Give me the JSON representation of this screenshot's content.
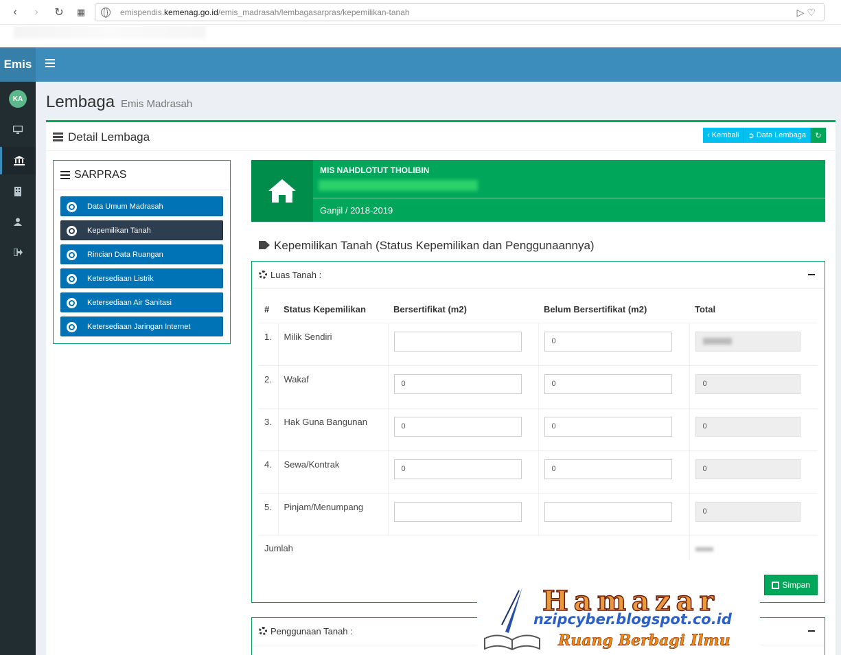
{
  "browser": {
    "url_prefix": "emispendis.",
    "url_domain": "kemenag.go.id",
    "url_path": "/emis_madrasah/lembagasarpras/kepemilikan-tanah"
  },
  "app": {
    "logo": "Emis",
    "avatar": "KA",
    "page_title": "Lembaga",
    "page_subtitle": "Emis Madrasah"
  },
  "box": {
    "title": "Detail Lembaga",
    "btn_back": "Kembali",
    "btn_data": "Data Lembaga"
  },
  "sarpras": {
    "title": "SARPRAS",
    "items": [
      {
        "label": "Data Umum Madrasah"
      },
      {
        "label": "Kepemilikan Tanah"
      },
      {
        "label": "Rincian Data Ruangan"
      },
      {
        "label": "Ketersediaan Listrik"
      },
      {
        "label": "Ketersediaan Air Sanitasi"
      },
      {
        "label": "Ketersediaan Jaringan Internet"
      }
    ]
  },
  "banner": {
    "name": "MIS NAHDLOTUT THOLIBIN",
    "semester": "Ganjil / 2018-2019"
  },
  "section": {
    "title": "Kepemilikan Tanah (Status Kepemilikan dan Penggunaannya)"
  },
  "luas": {
    "title": "Luas Tanah :",
    "headers": [
      "#",
      "Status Kepemilikan",
      "Bersertifikat (m2)",
      "Belum Bersertifikat (m2)",
      "Total"
    ],
    "rows": [
      {
        "no": "1.",
        "status": "Milik Sendiri",
        "cert": "",
        "noncert": "0",
        "total": ""
      },
      {
        "no": "2.",
        "status": "Wakaf",
        "cert": "0",
        "noncert": "0",
        "total": "0"
      },
      {
        "no": "3.",
        "status": "Hak Guna Bangunan",
        "cert": "0",
        "noncert": "0",
        "total": "0"
      },
      {
        "no": "4.",
        "status": "Sewa/Kontrak",
        "cert": "0",
        "noncert": "0",
        "total": "0"
      },
      {
        "no": "5.",
        "status": "Pinjam/Menumpang",
        "cert": "",
        "noncert": "",
        "total": "0"
      }
    ],
    "sum_label": "Jumlah",
    "save": "Simpan"
  },
  "penggunaan": {
    "title": "Penggunaan Tanah :"
  },
  "watermark": {
    "title": "Hamazar",
    "url": "nzipcyber.blogspot.co.id",
    "tagline": "Ruang Berbagi Ilmu"
  }
}
